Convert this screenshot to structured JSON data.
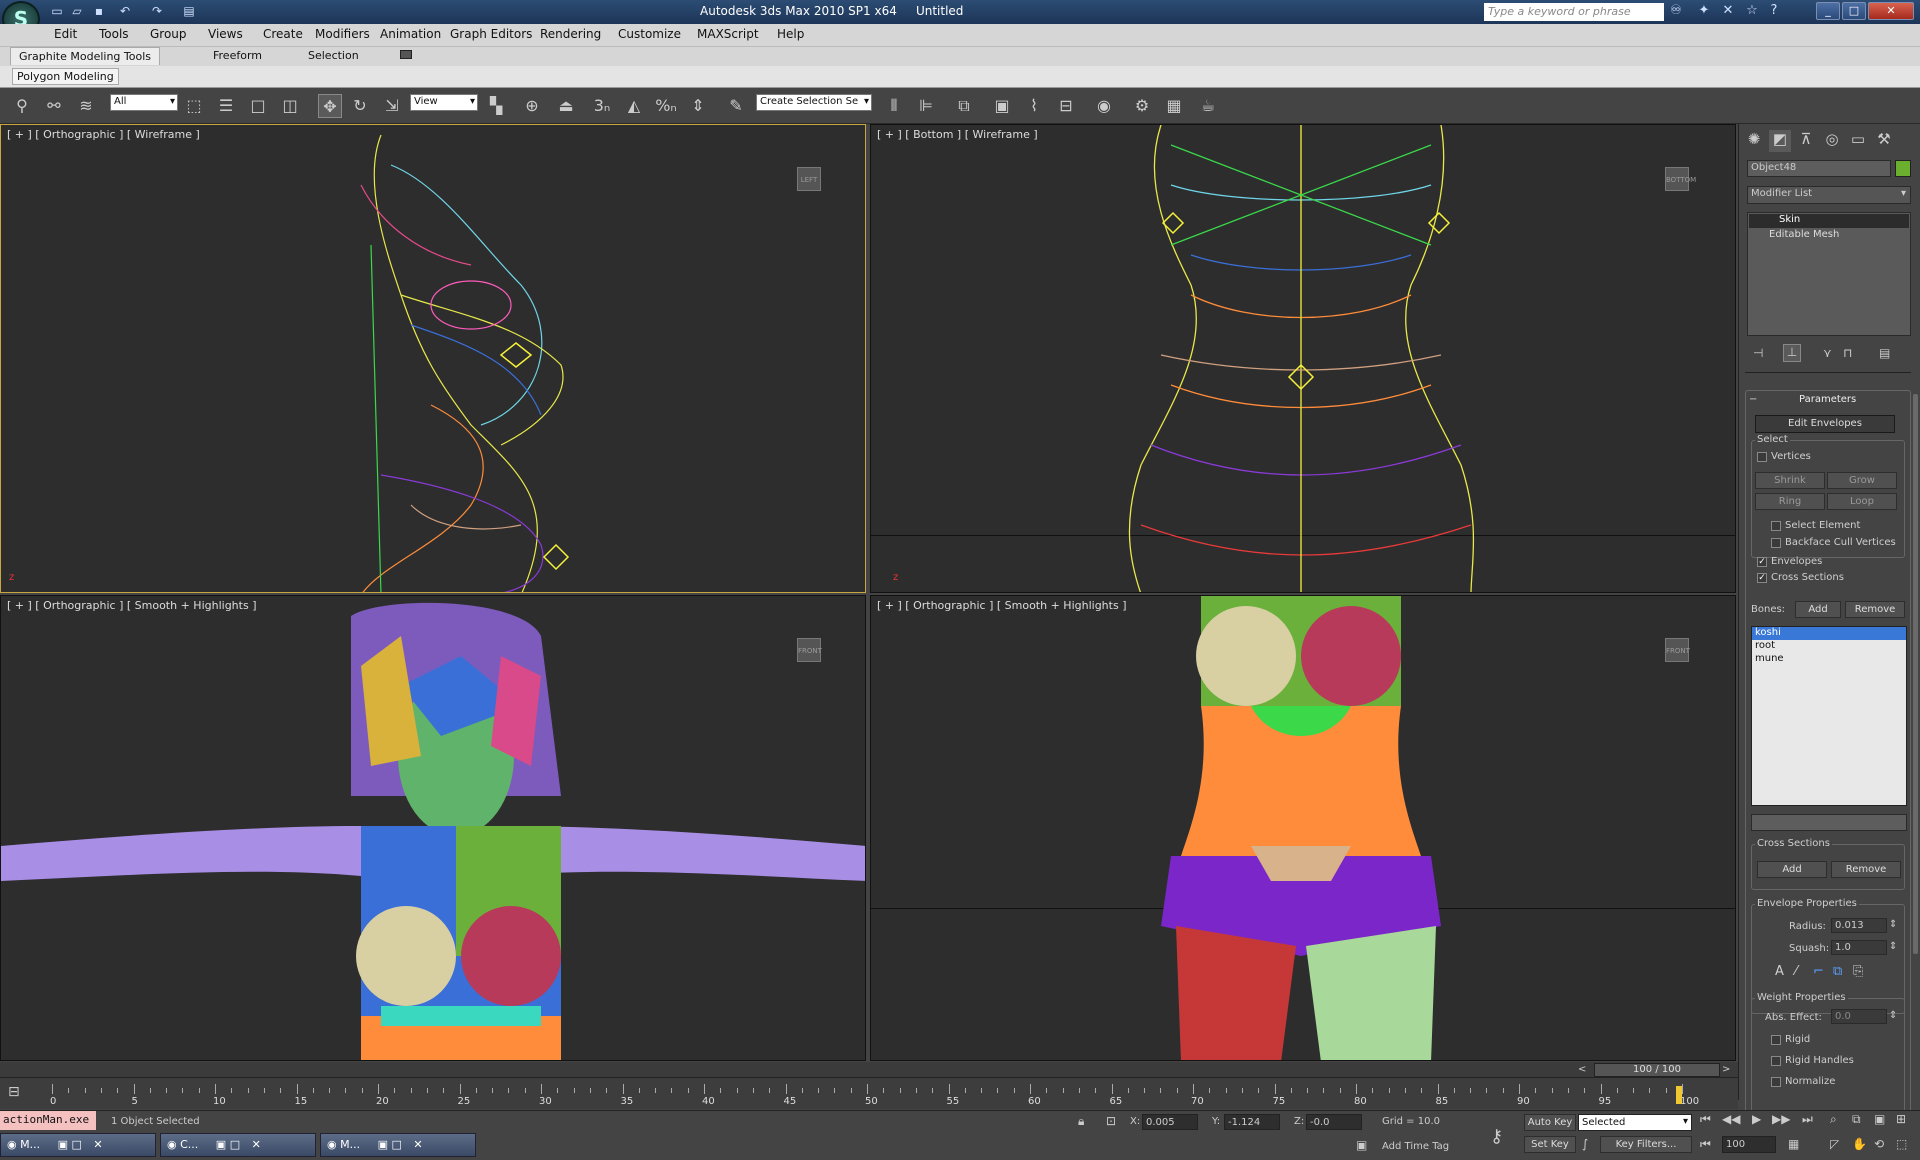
{
  "app": {
    "title": "Autodesk 3ds Max  2010 SP1 x64",
    "document": "Untitled",
    "search_placeholder": "Type a keyword or phrase"
  },
  "menus": [
    "Edit",
    "Tools",
    "Group",
    "Views",
    "Create",
    "Modifiers",
    "Animation",
    "Graph Editors",
    "Rendering",
    "Customize",
    "MAXScript",
    "Help"
  ],
  "ribbon": {
    "tabs": [
      "Graphite Modeling Tools",
      "Freeform",
      "Selection"
    ],
    "panel_label": "Polygon Modeling"
  },
  "toolbar": {
    "filter_value": "All",
    "refcoord_value": "View",
    "selection_set_value": "Create Selection Se"
  },
  "viewports": [
    {
      "label": "[ + ] [ Orthographic ] [ Wireframe ]"
    },
    {
      "label": "[ + ] [ Bottom ] [ Wireframe ]"
    },
    {
      "label": "[ + ] [ Orthographic ] [ Smooth + Highlights ]"
    },
    {
      "label": "[ + ] [ Orthographic ] [ Smooth + Highlights ]"
    }
  ],
  "command_panel": {
    "object_name": "Object48",
    "object_color": "#6ab02e",
    "modifier_list_label": "Modifier List",
    "stack": [
      "Skin",
      "Editable Mesh"
    ],
    "parameters": {
      "header": "Parameters",
      "edit_envelopes": "Edit Envelopes",
      "select_label": "Select",
      "vertices": "Vertices",
      "shrink": "Shrink",
      "grow": "Grow",
      "ring": "Ring",
      "loop": "Loop",
      "select_element": "Select Element",
      "backface": "Backface Cull Vertices",
      "envelopes": "Envelopes",
      "cross_sections": "Cross Sections",
      "bones_label": "Bones:",
      "add": "Add",
      "remove": "Remove",
      "bones": [
        "koshi",
        "root",
        "mune"
      ],
      "cross_sections_group": "Cross Sections",
      "cs_add": "Add",
      "cs_remove": "Remove",
      "envelope_props": "Envelope Properties",
      "radius_label": "Radius:",
      "radius_value": "0.013",
      "squash_label": "Squash:",
      "squash_value": "1.0",
      "weight_props": "Weight Properties",
      "abs_effect_label": "Abs. Effect:",
      "abs_effect_value": "0.0",
      "rigid": "Rigid",
      "rigid_handles": "Rigid Handles",
      "normalize": "Normalize"
    }
  },
  "timeline": {
    "frame_display": "100 / 100",
    "ticks": [
      "0",
      "5",
      "10",
      "15",
      "20",
      "25",
      "30",
      "35",
      "40",
      "45",
      "50",
      "55",
      "60",
      "65",
      "70",
      "75",
      "80",
      "85",
      "90",
      "95",
      "100"
    ]
  },
  "status": {
    "script_listener": "actionMan.exe",
    "selected": "1 Object Selected",
    "x_label": "X:",
    "x_value": "0.005",
    "y_label": "Y:",
    "y_value": "-1.124",
    "z_label": "Z:",
    "z_value": "-0.0",
    "grid": "Grid = 10.0",
    "add_time_tag": "Add Time Tag",
    "auto_key": "Auto Key",
    "set_key": "Set Key",
    "key_mode_value": "Selected",
    "key_filters": "Key Filters...",
    "frame_value": "100"
  },
  "taskbar": [
    {
      "label": "M..."
    },
    {
      "label": "C..."
    },
    {
      "label": "M..."
    }
  ]
}
